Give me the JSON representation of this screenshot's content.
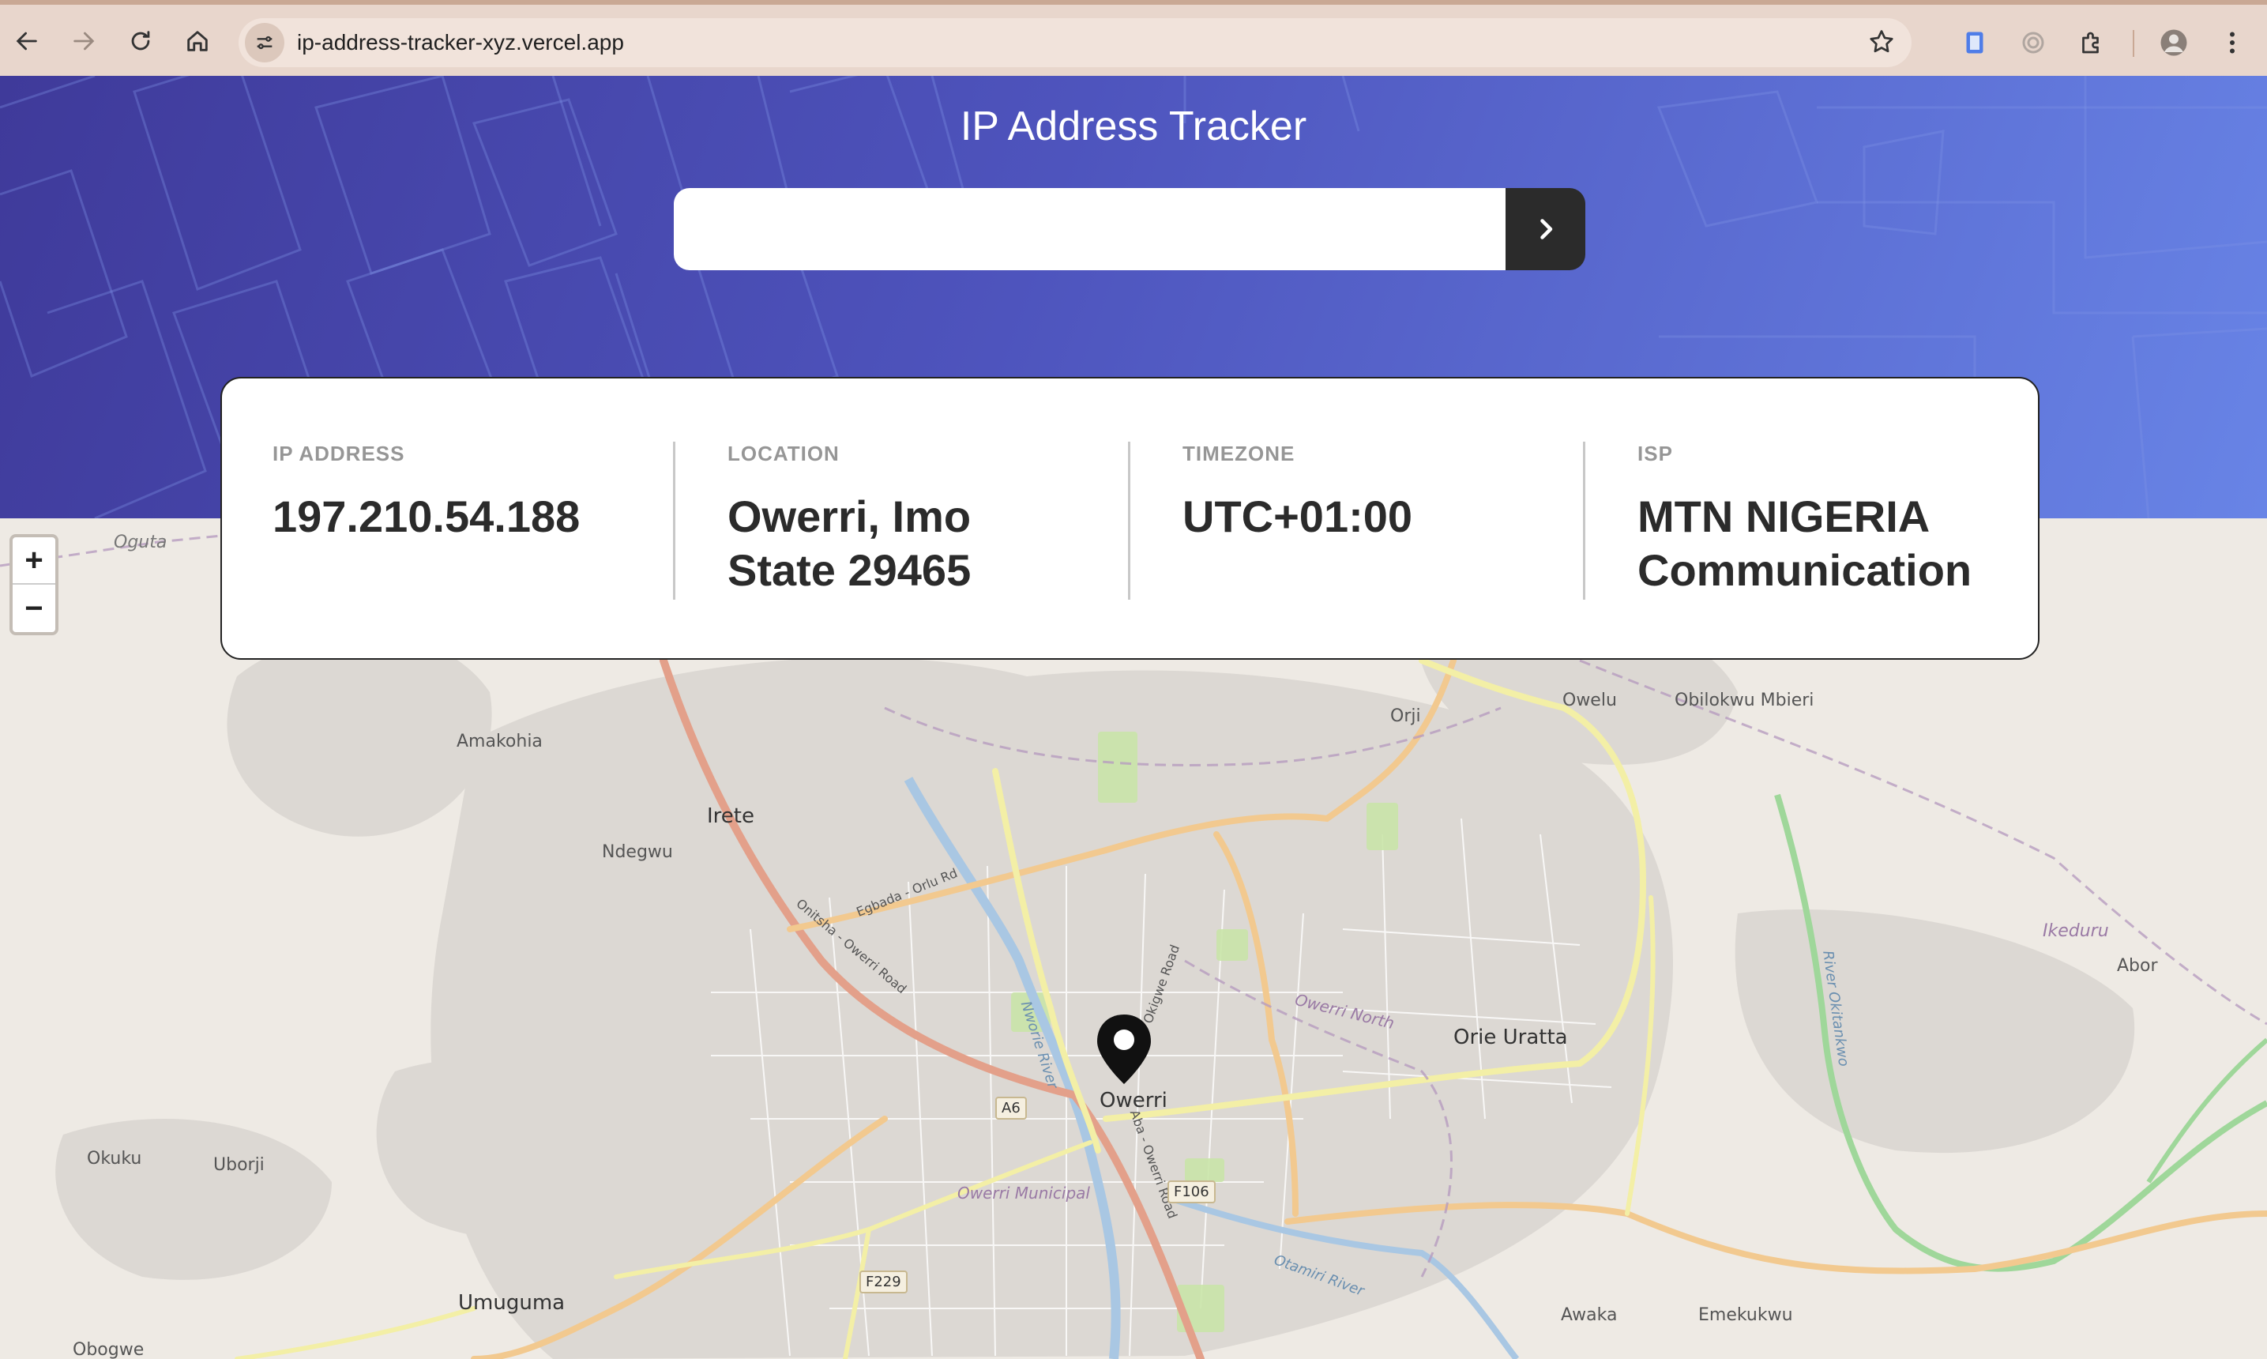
{
  "browser": {
    "url": "ip-address-tracker-xyz.vercel.app"
  },
  "header": {
    "title": "IP Address Tracker",
    "search_value": "",
    "search_placeholder": ""
  },
  "info": {
    "ip_label": "IP ADDRESS",
    "ip_value": "197.210.54.188",
    "location_label": "LOCATION",
    "location_value": "Owerri, Imo State 29465",
    "timezone_label": "TIMEZONE",
    "timezone_value": "UTC+01:00",
    "isp_label": "ISP",
    "isp_value": "MTN NIGERIA Communication"
  },
  "map": {
    "zoom_in": "+",
    "zoom_out": "−",
    "places": {
      "oguta": "Oguta",
      "amakohia": "Amakohia",
      "irete": "Irete",
      "ndegwu": "Ndegwu",
      "orji": "Orji",
      "owelu": "Owelu",
      "obilokwu": "Obilokwu Mbieri",
      "ikeduru": "Ikeduru",
      "abor": "Abor",
      "orie_uratta": "Orie Uratta",
      "owerri": "Owerri",
      "okuku": "Okuku",
      "uborji": "Uborji",
      "umuguma": "Umuguma",
      "obogwe": "Obogwe",
      "awaka": "Awaka",
      "emekukwu": "Emekukwu",
      "owerri_north": "Owerri North",
      "owerri_municipal": "Owerri Municipal",
      "otamiri": "Otamiri River",
      "egbada": "Egbada - Orlu Rd",
      "onitsha_road": "Onitsha - Owerri Road",
      "okigwe_road": "Okigwe Road",
      "aba_road": "Aba - Owerri Road",
      "a6": "A6",
      "f106": "F106",
      "f229": "F229",
      "nworie": "Nworie River",
      "okitankwo": "River Okitankwo"
    }
  },
  "colors": {
    "hero_start": "#3f3a9a",
    "hero_end": "#6884e6",
    "dark": "#2b2b2b",
    "label_gray": "#969696"
  }
}
